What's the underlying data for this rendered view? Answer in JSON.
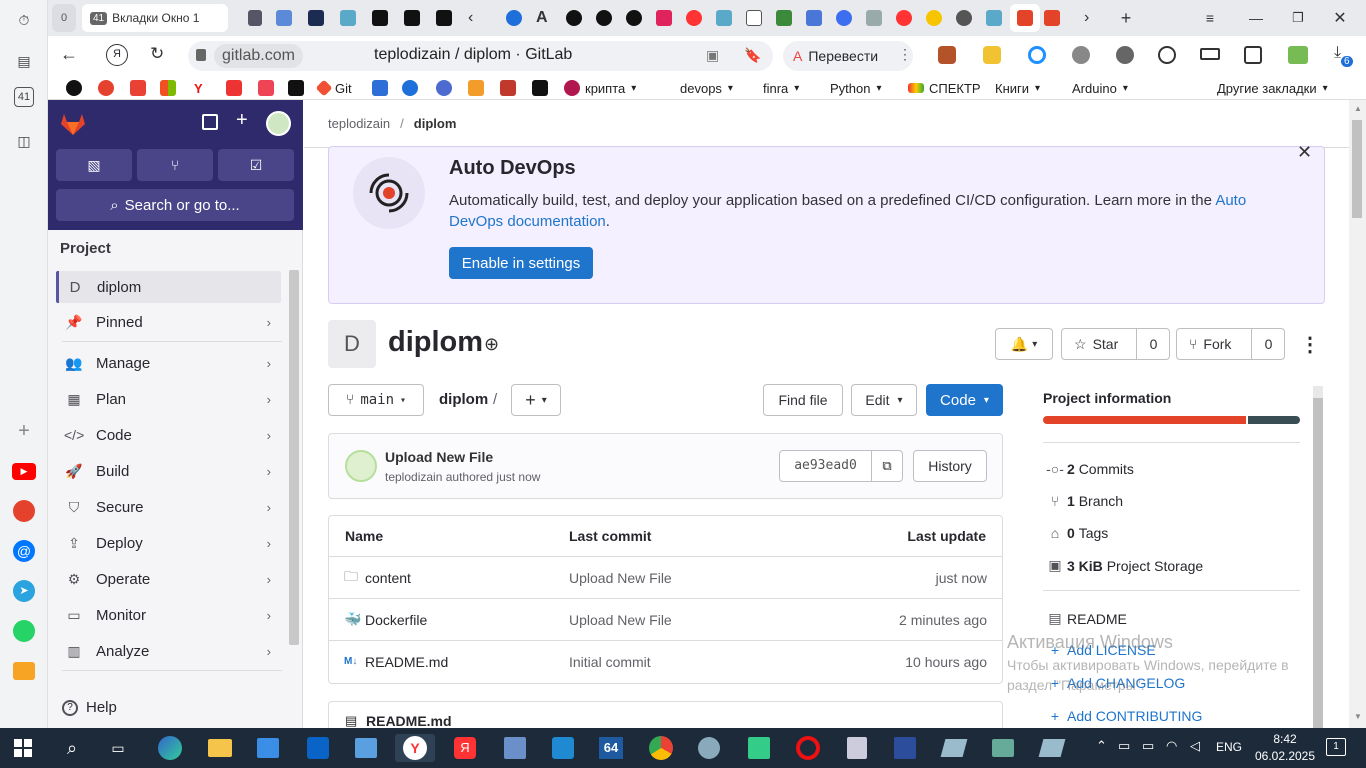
{
  "browser": {
    "tab_count": "41",
    "active_tab_title": "Вкладки Окно 1",
    "url_host": "gitlab.com",
    "page_title": "teplodizain / diplom · GitLab",
    "translate_label": "Перевести",
    "extension_badge": "6"
  },
  "bookmarks": [
    {
      "label": "Git"
    },
    {
      "label": "крипта"
    },
    {
      "label": "devops"
    },
    {
      "label": "finra"
    },
    {
      "label": "Python"
    },
    {
      "label": "СПЕКТР"
    },
    {
      "label": "Книги"
    },
    {
      "label": "Arduino"
    },
    {
      "label": "Другие закладки"
    }
  ],
  "sidebar": {
    "search_label": "Search or go to...",
    "section": "Project",
    "project_initial": "D",
    "project_name": "diplom",
    "items": [
      {
        "label": "Pinned"
      },
      {
        "label": "Manage"
      },
      {
        "label": "Plan"
      },
      {
        "label": "Code"
      },
      {
        "label": "Build"
      },
      {
        "label": "Secure"
      },
      {
        "label": "Deploy"
      },
      {
        "label": "Operate"
      },
      {
        "label": "Monitor"
      },
      {
        "label": "Analyze"
      }
    ],
    "help": "Help"
  },
  "breadcrumb": {
    "group": "teplodizain",
    "project": "diplom"
  },
  "devops": {
    "title": "Auto DevOps",
    "text": "Automatically build, test, and deploy your application based on a predefined CI/CD configuration. Learn more in the",
    "link1": "Auto",
    "link2": "DevOps documentation",
    "period": ".",
    "button": "Enable in settings"
  },
  "project": {
    "initial": "D",
    "name": "diplom",
    "star_label": "Star",
    "star_count": "0",
    "fork_label": "Fork",
    "fork_count": "0"
  },
  "repo": {
    "branch": "main",
    "path": "diplom",
    "separator": "/",
    "find_file": "Find file",
    "edit": "Edit",
    "code": "Code"
  },
  "commit": {
    "title": "Upload New File",
    "author": "teplodizain",
    "meta": "authored just now",
    "sha": "ae93ead0",
    "history": "History"
  },
  "table": {
    "headers": [
      "Name",
      "Last commit",
      "Last update"
    ],
    "rows": [
      {
        "icon": "folder-icon",
        "name": "content",
        "commit": "Upload New File",
        "update": "just now"
      },
      {
        "icon": "docker-icon",
        "name": "Dockerfile",
        "commit": "Upload New File",
        "update": "2 minutes ago"
      },
      {
        "icon": "markdown-icon",
        "name": "README.md",
        "commit": "Initial commit",
        "update": "10 hours ago"
      }
    ],
    "readme_header": "README.md"
  },
  "info": {
    "title": "Project information",
    "commits_count": "2",
    "commits_label": "Commits",
    "branch_count": "1",
    "branch_label": "Branch",
    "tags_count": "0",
    "tags_label": "Tags",
    "storage_count": "3 KiB",
    "storage_label": "Project Storage",
    "readme": "README",
    "add_license": "Add LICENSE",
    "add_changelog": "Add CHANGELOG",
    "add_contributing": "Add CONTRIBUTING"
  },
  "watermark": {
    "line1": "Активация Windows",
    "line2": "Чтобы активировать Windows, перейдите в",
    "line3": "раздел \"Параметры\"."
  },
  "taskbar": {
    "lang": "ENG",
    "time": "8:42",
    "date": "06.02.2025",
    "notif": "1",
    "app64": "64"
  },
  "colors": {
    "gitlab_purple": "#2f2a6b",
    "confirm_blue": "#1f75cb",
    "orange": "#e24329",
    "banner_bg": "#f4f0ff"
  }
}
